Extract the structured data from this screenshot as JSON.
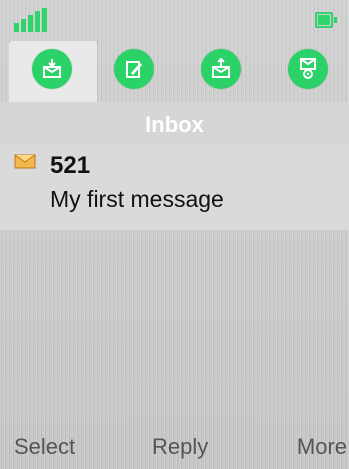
{
  "header": {
    "title": "Inbox"
  },
  "tabs": [
    {
      "icon": "inbox-download-icon",
      "active": true
    },
    {
      "icon": "compose-icon",
      "active": false
    },
    {
      "icon": "outbox-upload-icon",
      "active": false
    },
    {
      "icon": "settings-envelope-icon",
      "active": false
    }
  ],
  "message": {
    "count": "521",
    "subject": "My first message",
    "icon": "envelope-icon"
  },
  "softkeys": {
    "left": "Select",
    "center": "Reply",
    "right": "More"
  },
  "colors": {
    "accent": "#2ad267",
    "text": "#111111",
    "softkey": "#555555",
    "title": "#ffffff"
  }
}
